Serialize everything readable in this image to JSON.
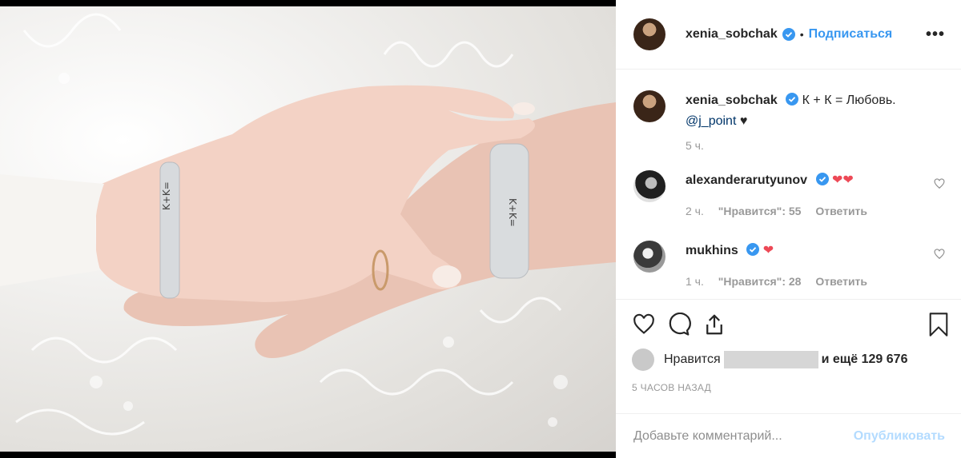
{
  "post": {
    "author": "xenia_sobchak",
    "follow_label": "Подписаться",
    "dot": "•",
    "more": "•••",
    "caption_text": "К + К = Любовь.",
    "caption_mention": "@j_point",
    "caption_emoji": "♥",
    "caption_time": "5 ч.",
    "likes_prefix": "Нравится",
    "likes_suffix": "и ещё 129 676",
    "timestamp": "5 ЧАСОВ НАЗАД",
    "photo_bracelet_text": "K+K="
  },
  "comments": [
    {
      "user": "alexanderarutyunov",
      "text": "❤❤",
      "time": "2 ч.",
      "likes": "\"Нравится\": 55",
      "reply": "Ответить"
    },
    {
      "user": "mukhins",
      "text": "❤",
      "time": "1 ч.",
      "likes": "\"Нравится\": 28",
      "reply": "Ответить"
    }
  ],
  "composer": {
    "placeholder": "Добавьте комментарий...",
    "publish_label": "Опубликовать"
  },
  "colors": {
    "link": "#3897f0",
    "publish_disabled": "#b3dbff",
    "heart": "#ed4956"
  }
}
